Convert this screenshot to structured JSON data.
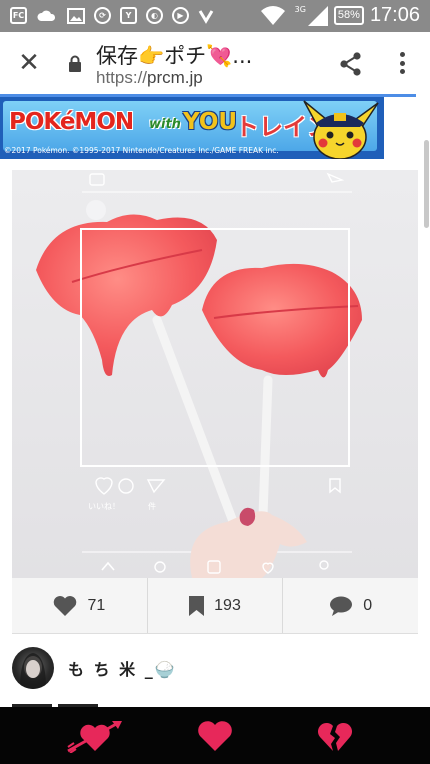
{
  "status_bar": {
    "network": "3G",
    "battery": "58%",
    "time": "17:06",
    "left_icons": [
      "notification-icon",
      "weather-icon",
      "image-icon",
      "sync-icon",
      "app-icon",
      "app-icon",
      "app-icon",
      "check-icon"
    ],
    "right_icons": [
      "wifi-icon",
      "signal-icon",
      "battery-icon"
    ]
  },
  "browser": {
    "title": "保存👉ポチ💘...",
    "url_scheme": "https://",
    "url_host": "prcm.jp",
    "icons": [
      "close-icon",
      "lock-icon",
      "share-icon",
      "more-vert-icon"
    ],
    "accent": "#4d8de6"
  },
  "ad": {
    "pokemon": "POKéMON",
    "with": "with",
    "you": "YOU",
    "train": "トレイン",
    "copyright": "©2017 Pokémon. ©1995-2017 Nintendo/Creatures Inc./GAME FREAK inc."
  },
  "post": {
    "overlay_like_text": "いいね！",
    "overlay_count_text": "件"
  },
  "stats": {
    "likes": "71",
    "saves": "193",
    "comments": "0",
    "icons": [
      "heart-icon",
      "bookmark-icon",
      "comment-icon"
    ]
  },
  "user": {
    "name": "も ち 米 _🍚"
  },
  "bottom_bar": {
    "icons": [
      "heart-arrow-icon",
      "heart-icon",
      "broken-heart-icon"
    ],
    "color": "#e7285a"
  }
}
